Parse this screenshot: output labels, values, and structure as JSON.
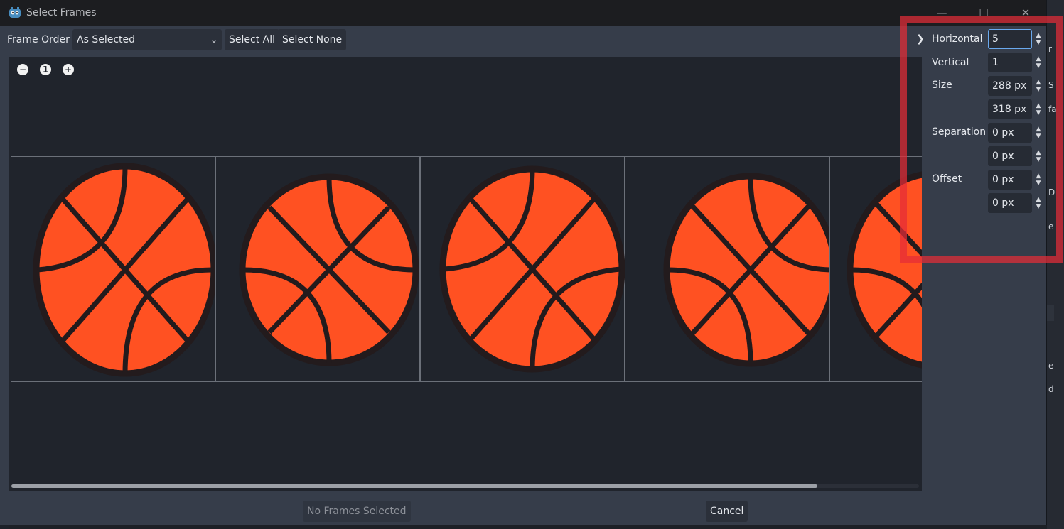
{
  "window": {
    "title": "Select Frames"
  },
  "toolbar": {
    "frame_order_label": "Frame Order",
    "frame_order_value": "As Selected",
    "select_all": "Select All",
    "select_none": "Select None"
  },
  "zoom": {
    "out": "−",
    "reset": "1",
    "in": "+"
  },
  "grid": {
    "horizontal_label": "Horizontal",
    "horizontal_value": "5",
    "vertical_label": "Vertical",
    "vertical_value": "1",
    "size_label": "Size",
    "size_x": "288 px",
    "size_y": "318 px",
    "separation_label": "Separation",
    "separation_x": "0 px",
    "separation_y": "0 px",
    "offset_label": "Offset",
    "offset_x": "0 px",
    "offset_y": "0 px"
  },
  "footer": {
    "status": "No Frames Selected",
    "cancel": "Cancel"
  },
  "background_fragments": [
    "r",
    "S",
    "fa",
    "D",
    "e",
    "e",
    "d"
  ],
  "colors": {
    "ball": "#ff5122",
    "ball_line": "#231b1d",
    "accent": "#6aa9ee",
    "highlight": "#e42d37"
  },
  "icons": [
    "godot-icon",
    "minimize-icon",
    "maximize-icon",
    "close-icon",
    "chevron-down-icon",
    "zoom-out-icon",
    "zoom-reset-icon",
    "zoom-in-icon",
    "chevron-right-icon",
    "spinner-arrows-icon"
  ]
}
